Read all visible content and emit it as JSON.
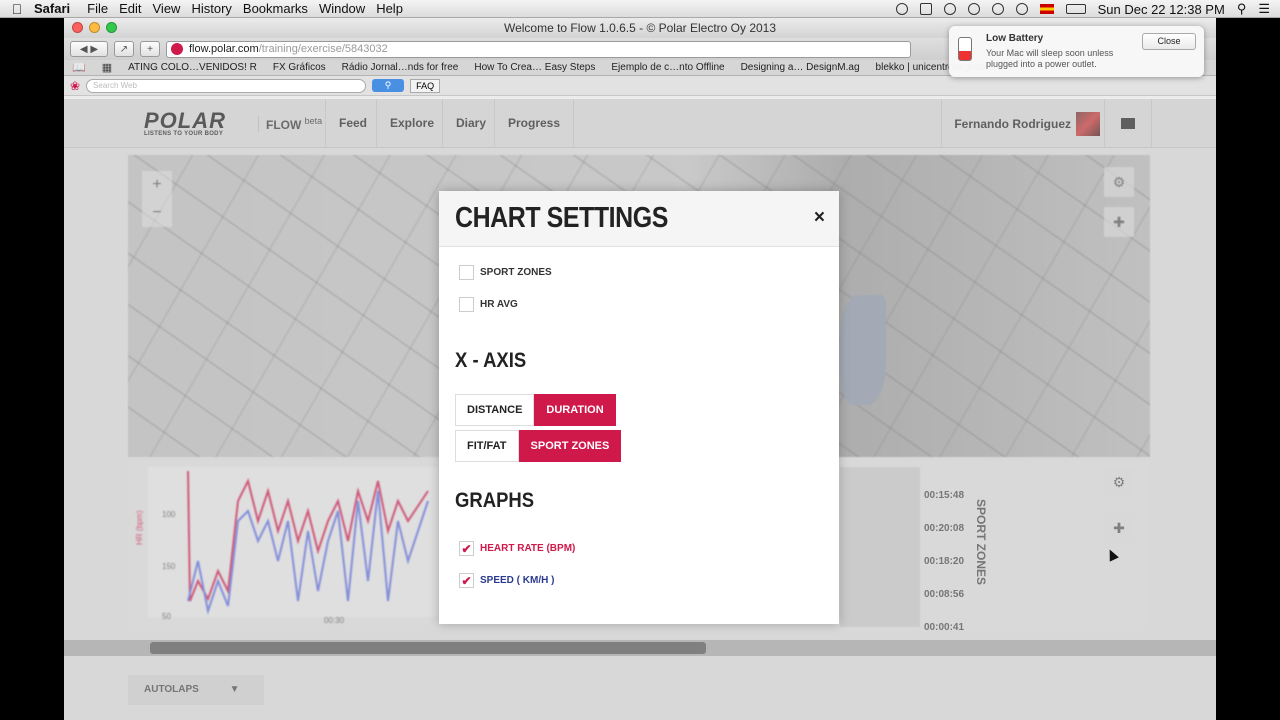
{
  "menubar": {
    "app": "Safari",
    "items": [
      "File",
      "Edit",
      "View",
      "History",
      "Bookmarks",
      "Window",
      "Help"
    ],
    "clock": "Sun Dec 22  12:38 PM"
  },
  "window": {
    "title": "Welcome to Flow 1.0.6.5 - © Polar Electro Oy 2013"
  },
  "url": {
    "host": "flow.polar.com",
    "path": "/training/exercise/5843032"
  },
  "bookmarks": [
    "ATING COLO…VENIDOS! R",
    "FX Gráficos",
    "Rádio Jornal…nds for free",
    "How To Crea… Easy Steps",
    "Ejemplo de c…nto Offline",
    "Designing a… DesignM.ag",
    "blekko | unicentrobogota"
  ],
  "searchbar": {
    "placeholder": "Search Web",
    "faq": "FAQ"
  },
  "header": {
    "logo": "POLAR",
    "tagline": "LISTENS TO YOUR BODY",
    "flow": "FLOW",
    "beta": "beta",
    "nav": [
      "Feed",
      "Explore",
      "Diary",
      "Progress"
    ],
    "user": "Fernando Rodriguez"
  },
  "modal": {
    "title": "CHART SETTINGS",
    "close": "×",
    "checkboxes": [
      {
        "label": "SPORT ZONES",
        "checked": false
      },
      {
        "label": "HR AVG",
        "checked": false
      }
    ],
    "xaxis_title": "X - AXIS",
    "xaxis_row1": [
      {
        "label": "DISTANCE",
        "active": false
      },
      {
        "label": "DURATION",
        "active": true
      }
    ],
    "xaxis_row2": [
      {
        "label": "FIT/FAT",
        "active": false
      },
      {
        "label": "SPORT ZONES",
        "active": true
      }
    ],
    "graphs_title": "GRAPHS",
    "graphs": [
      {
        "label": "HEART RATE (BPM)",
        "checked": true,
        "color": "#d0194b"
      },
      {
        "label": "SPEED ( KM/H )",
        "checked": true,
        "color": "#2a3b8f"
      }
    ]
  },
  "notification": {
    "title": "Low Battery",
    "body": "Your Mac will sleep soon unless plugged into a power outlet.",
    "close": "Close"
  },
  "background": {
    "autolaps": "AUTOLAPS",
    "zone_times": [
      "00:15:48",
      "00:20:08",
      "00:18:20",
      "00:08:56",
      "00:00:41"
    ],
    "zones_label": "SPORT ZONES",
    "y_label": "HR (bpm)",
    "ticks": [
      "100",
      "150",
      "50"
    ],
    "x_tick": "00:30"
  },
  "colors": {
    "accent": "#d0194b",
    "navy": "#2a3b8f"
  }
}
